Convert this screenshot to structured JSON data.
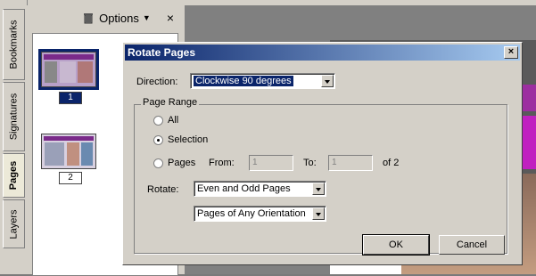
{
  "side_tabs": [
    {
      "label": "Bookmarks"
    },
    {
      "label": "Signatures"
    },
    {
      "label": "Pages"
    },
    {
      "label": "Layers"
    }
  ],
  "pages_panel": {
    "options_label": "Options",
    "close_glyph": "×",
    "thumbnails": [
      {
        "page_number": "1",
        "selected": true
      },
      {
        "page_number": "2",
        "selected": false
      }
    ]
  },
  "dialog": {
    "title": "Rotate Pages",
    "close_glyph": "×",
    "direction_label": "Direction:",
    "direction_value": "Clockwise 90 degrees",
    "page_range_label": "Page Range",
    "all_label": "All",
    "selection_label": "Selection",
    "pages_label": "Pages",
    "from_label": "From:",
    "from_value": "1",
    "to_label": "To:",
    "to_value": "1",
    "of_label": "of 2",
    "rotate_label": "Rotate:",
    "rotate_value": "Even and Odd Pages",
    "orientation_value": "Pages of Any Orientation",
    "ok_label": "OK",
    "cancel_label": "Cancel",
    "selected_range": "selection"
  },
  "colors": {
    "title_start": "#0a246a",
    "title_end": "#a6caf0",
    "dialog_bg": "#d4d0c8"
  }
}
